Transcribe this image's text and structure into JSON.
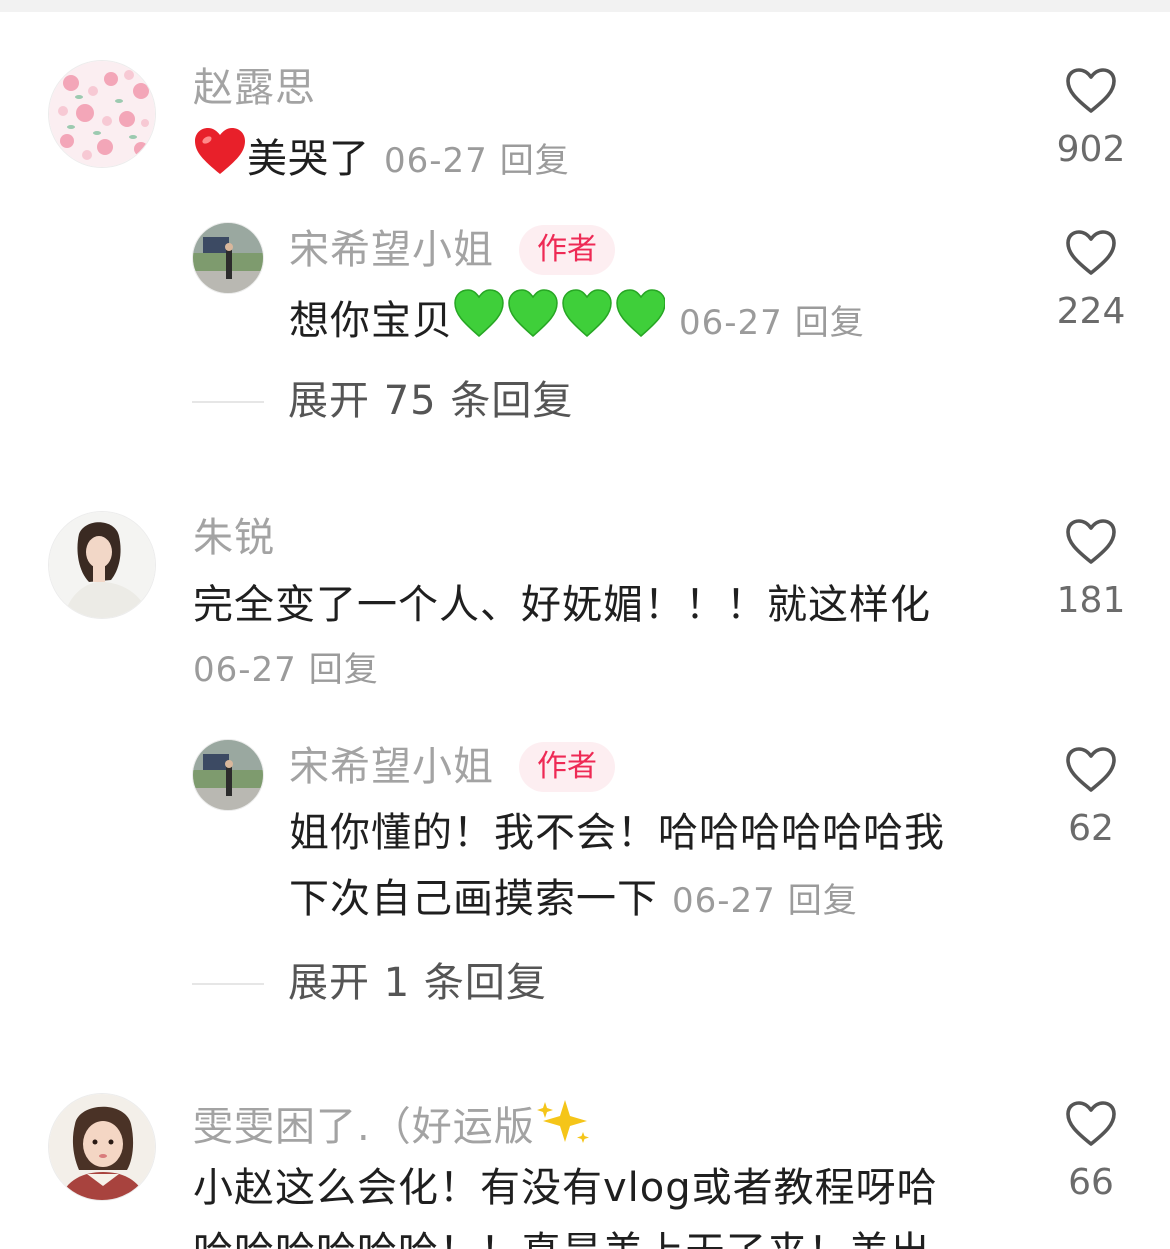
{
  "comments": [
    {
      "name": "赵露思",
      "text": "美哭了",
      "date": "06-27",
      "reply_label": "回复",
      "likes": "902",
      "avatar_icon": "floral-pattern-avatar-icon",
      "replies": [
        {
          "name": "宋希望小姐",
          "badge": "作者",
          "text": "想你宝贝",
          "date": "06-27",
          "reply_label": "回复",
          "likes": "224",
          "avatar_icon": "person-outdoor-avatar-icon"
        }
      ],
      "expand_label": "展开 75 条回复"
    },
    {
      "name": "朱锐",
      "text_lines": [
        "完全变了一个人、好妩媚！！！就这样化"
      ],
      "date": "06-27",
      "reply_label": "回复",
      "likes": "181",
      "avatar_icon": "woman-portrait-avatar-icon",
      "replies": [
        {
          "name": "宋希望小姐",
          "badge": "作者",
          "text_lines": [
            "姐你懂的！我不会！哈哈哈哈哈哈我",
            "下次自己画摸索一下"
          ],
          "date": "06-27",
          "reply_label": "回复",
          "likes": "62",
          "avatar_icon": "person-outdoor-avatar-icon"
        }
      ],
      "expand_label": "展开 1 条回复"
    },
    {
      "name": "雯雯困了.（好运版",
      "text_lines": [
        "小赵这么会化！有没有vlog或者教程呀哈",
        "哈哈哈哈哈哈！！真是美上天了来！美出"
      ],
      "likes": "66",
      "avatar_icon": "girl-portrait-avatar-icon"
    }
  ],
  "icons": {
    "like": "heart-outline-icon",
    "red_heart": "red-heart-emoji-icon",
    "green_heart": "green-heart-emoji-icon",
    "sparkles": "sparkles-emoji-icon"
  },
  "colors": {
    "author_badge_text": "#ee2a55",
    "author_badge_bg": "#fdeef1",
    "name": "#a3a3a3",
    "meta": "#9b9b9b"
  }
}
